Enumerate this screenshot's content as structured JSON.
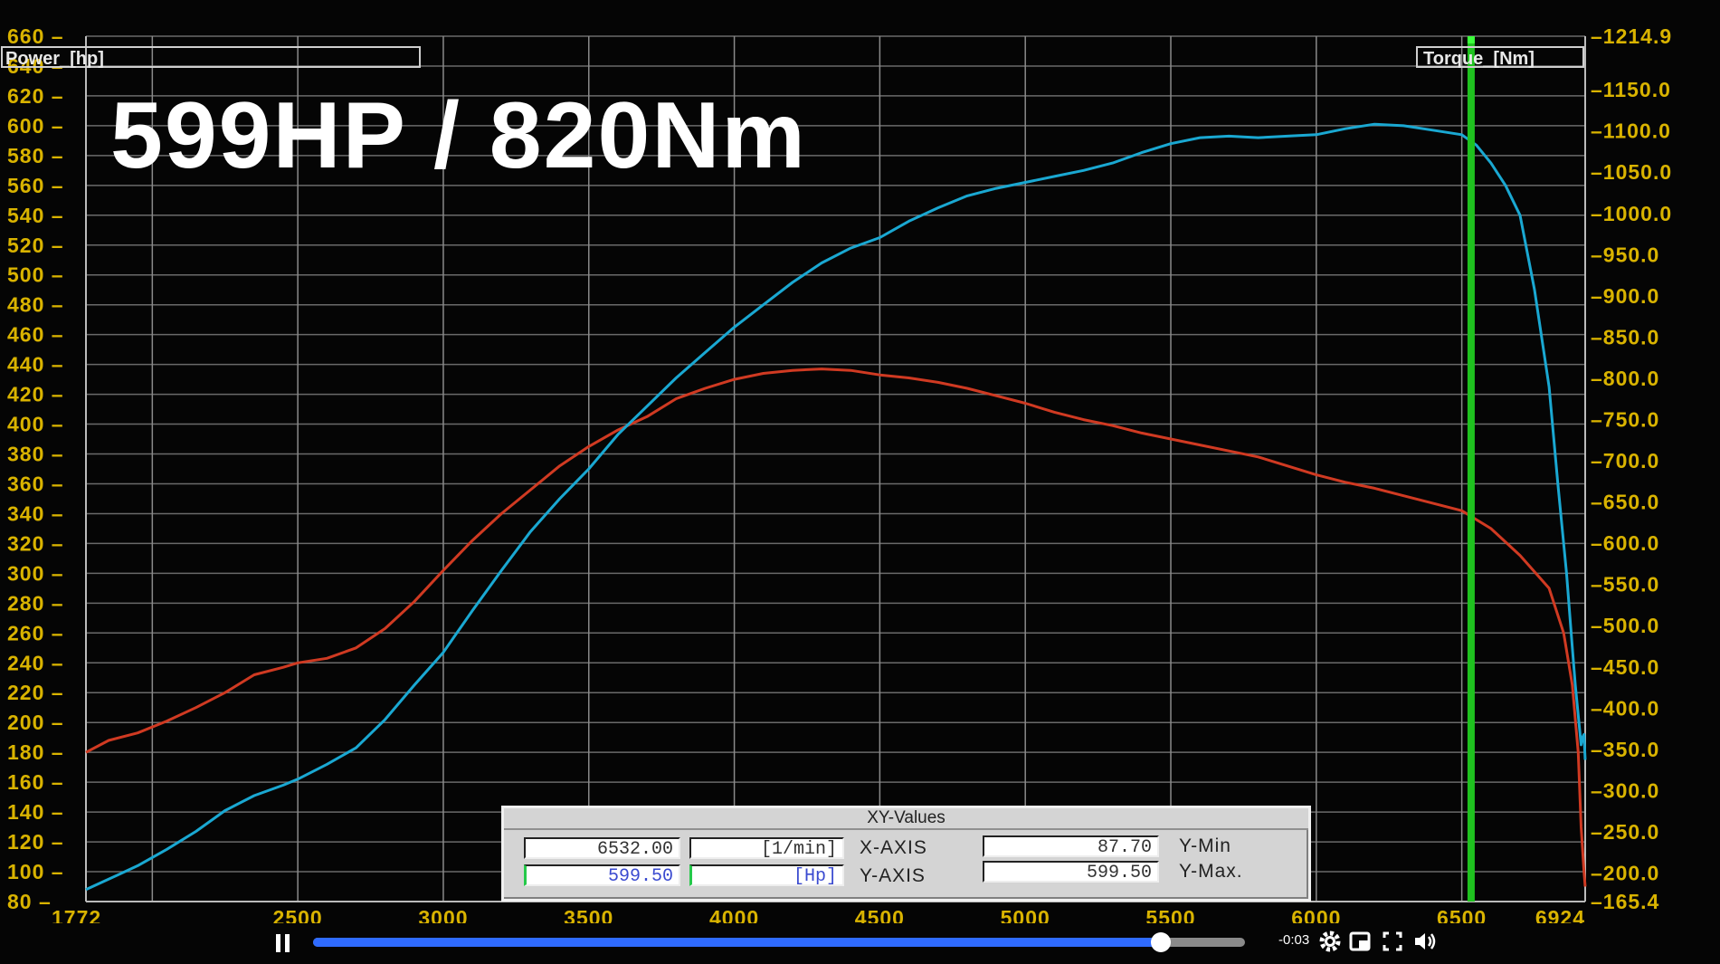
{
  "overlay_title": "599HP / 820Nm",
  "chart_data": {
    "type": "line",
    "x_ticks": [
      "1772",
      "2500",
      "3000",
      "3500",
      "4000",
      "4500",
      "5000",
      "5500",
      "6000",
      "6500",
      "6924"
    ],
    "xlim": [
      1772,
      6924
    ],
    "left_axis": {
      "label": "Power_[hp]",
      "ylim": [
        80,
        660
      ],
      "ticks": [
        "660",
        "640",
        "620",
        "600",
        "580",
        "560",
        "540",
        "520",
        "500",
        "480",
        "460",
        "440",
        "420",
        "400",
        "380",
        "360",
        "340",
        "320",
        "300",
        "280",
        "260",
        "240",
        "220",
        "200",
        "180",
        "160",
        "140",
        "120",
        "100",
        "80"
      ]
    },
    "right_axis": {
      "label": "Torque_[Nm]",
      "ylim": [
        165.4,
        1214.9
      ],
      "ticks": [
        "1214.9",
        "1150.0",
        "1100.0",
        "1050.0",
        "1000.0",
        "950.0",
        "900.0",
        "850.0",
        "800.0",
        "750.0",
        "700.0",
        "650.0",
        "600.0",
        "550.0",
        "500.0",
        "450.0",
        "400.0",
        "350.0",
        "300.0",
        "250.0",
        "200.0",
        "165.4"
      ]
    },
    "series": [
      {
        "axis": "left",
        "color": "#d03a22",
        "x": [
          1772,
          1850,
          1950,
          2050,
          2150,
          2250,
          2350,
          2450,
          2500,
          2600,
          2700,
          2800,
          2900,
          3000,
          3100,
          3200,
          3300,
          3400,
          3500,
          3600,
          3700,
          3800,
          3900,
          4000,
          4100,
          4200,
          4300,
          4400,
          4500,
          4600,
          4700,
          4800,
          4900,
          5000,
          5100,
          5200,
          5300,
          5400,
          5500,
          5600,
          5700,
          5800,
          5900,
          6000,
          6100,
          6200,
          6300,
          6400,
          6500,
          6600,
          6700,
          6800,
          6850,
          6880,
          6900,
          6910,
          6920,
          6924
        ],
        "y": [
          180,
          188,
          193,
          201,
          210,
          220,
          232,
          237,
          240,
          243,
          250,
          263,
          281,
          302,
          322,
          340,
          356,
          372,
          385,
          396,
          405,
          417,
          424,
          430,
          434,
          436,
          437,
          436,
          433,
          431,
          428,
          424,
          419,
          414,
          408,
          403,
          399,
          394,
          390,
          386,
          382,
          378,
          372,
          366,
          361,
          357,
          352,
          347,
          342,
          330,
          312,
          290,
          260,
          225,
          180,
          130,
          100,
          90
        ]
      },
      {
        "axis": "left",
        "color": "#1aa8d2",
        "x": [
          1772,
          1850,
          1950,
          2050,
          2150,
          2250,
          2350,
          2450,
          2500,
          2600,
          2700,
          2800,
          2900,
          3000,
          3100,
          3200,
          3300,
          3400,
          3500,
          3600,
          3700,
          3800,
          3900,
          4000,
          4100,
          4200,
          4300,
          4400,
          4500,
          4600,
          4700,
          4800,
          4900,
          5000,
          5100,
          5200,
          5300,
          5400,
          5500,
          5600,
          5700,
          5800,
          5900,
          6000,
          6100,
          6200,
          6300,
          6400,
          6500,
          6550,
          6600,
          6650,
          6700,
          6750,
          6800,
          6830,
          6860,
          6880,
          6890,
          6900,
          6905,
          6910,
          6915,
          6920,
          6924
        ],
        "y": [
          88,
          95,
          104,
          115,
          127,
          141,
          151,
          158,
          162,
          172,
          183,
          202,
          225,
          247,
          275,
          302,
          328,
          350,
          370,
          393,
          412,
          431,
          448,
          465,
          480,
          495,
          508,
          518,
          525,
          536,
          545,
          553,
          558,
          562,
          566,
          570,
          575,
          582,
          588,
          592,
          593,
          592,
          593,
          594,
          598,
          601,
          600,
          597,
          594,
          587,
          575,
          560,
          540,
          490,
          425,
          360,
          300,
          250,
          225,
          205,
          195,
          185,
          190,
          192,
          175
        ]
      }
    ],
    "cursor_x": 6532,
    "grid": true
  },
  "xy_panel": {
    "title": "XY-Values",
    "x_value": "6532.00",
    "x_unit": "[1/min]",
    "x_axis_label": "X-AXIS",
    "y_value": "599.50",
    "y_unit": "[Hp]",
    "y_axis_label": "Y-AXIS",
    "ymin_value": "87.70",
    "ymin_label": "Y-Min",
    "ymax_value": "599.50",
    "ymax_label": "Y-Max."
  },
  "player": {
    "time_remaining": "-0:03",
    "progress": 0.91,
    "progress_color": "#2f6bff"
  }
}
